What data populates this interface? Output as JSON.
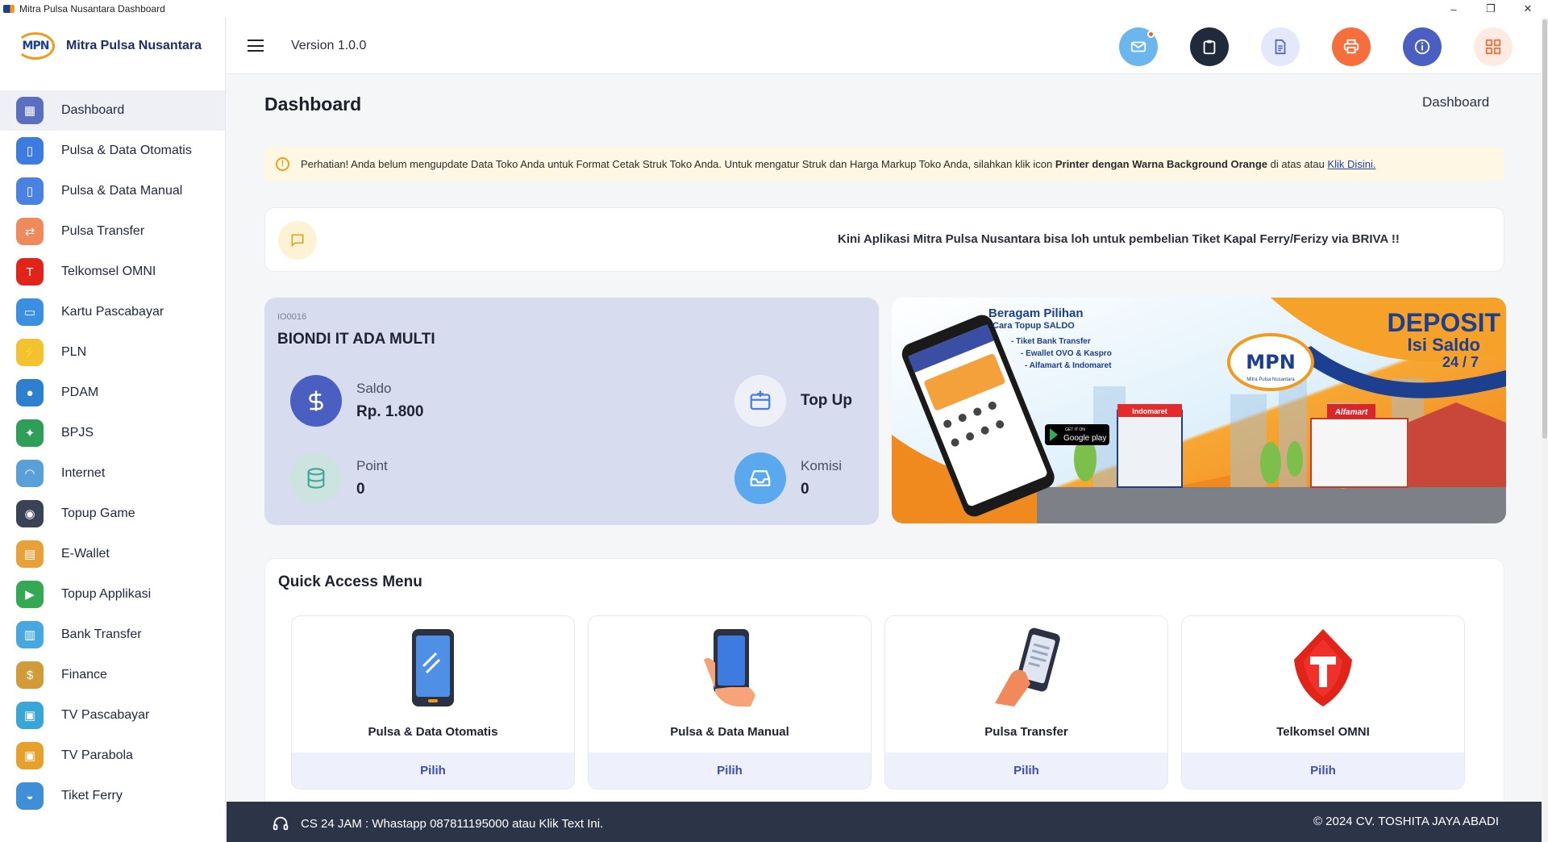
{
  "window": {
    "title": "Mitra Pulsa Nusantara Dashboard"
  },
  "brand": {
    "logo_text": "MPN",
    "name": "Mitra Pulsa Nusantara"
  },
  "header": {
    "version": "Version 1.0.0"
  },
  "sidebar": {
    "items": [
      {
        "label": "Dashboard",
        "icon": "dashboard-icon",
        "color": "#5a6fbf"
      },
      {
        "label": "Pulsa & Data Otomatis",
        "icon": "phone-icon",
        "color": "#3d7be0"
      },
      {
        "label": "Pulsa & Data Manual",
        "icon": "phone-hand-icon",
        "color": "#4a82e4"
      },
      {
        "label": "Pulsa Transfer",
        "icon": "transfer-icon",
        "color": "#f08a5d"
      },
      {
        "label": "Telkomsel OMNI",
        "icon": "telkomsel-icon",
        "color": "#e2231a"
      },
      {
        "label": "Kartu Pascabayar",
        "icon": "card-icon",
        "color": "#3b8fe0"
      },
      {
        "label": "PLN",
        "icon": "pln-icon",
        "color": "#f2c230"
      },
      {
        "label": "PDAM",
        "icon": "water-drop-icon",
        "color": "#2d7fd0"
      },
      {
        "label": "BPJS",
        "icon": "bpjs-icon",
        "color": "#2f9e58"
      },
      {
        "label": "Internet",
        "icon": "wifi-icon",
        "color": "#5aa0d8"
      },
      {
        "label": "Topup Game",
        "icon": "gamepad-icon",
        "color": "#3a4356"
      },
      {
        "label": "E-Wallet",
        "icon": "wallet-icon",
        "color": "#e8a13a"
      },
      {
        "label": "Topup Applikasi",
        "icon": "play-store-icon",
        "color": "#34a853"
      },
      {
        "label": "Bank Transfer",
        "icon": "bank-icon",
        "color": "#47a7e0"
      },
      {
        "label": "Finance",
        "icon": "finance-icon",
        "color": "#d19b3a"
      },
      {
        "label": "TV Pascabayar",
        "icon": "tv-icon",
        "color": "#3aa6d8"
      },
      {
        "label": "TV Parabola",
        "icon": "tv-antenna-icon",
        "color": "#e6a02b"
      },
      {
        "label": "Tiket Ferry",
        "icon": "ship-icon",
        "color": "#3f8ed8"
      }
    ]
  },
  "page": {
    "title": "Dashboard",
    "breadcrumb": "Dashboard"
  },
  "alert": {
    "text_1": "Perhatian! Anda belum mengupdate Data Toko Anda untuk Format Cetak Struk Toko Anda. Untuk mengatur Struk dan Harga Markup Toko Anda, silahkan klik icon ",
    "bold": "Printer dengan Warna Background Orange",
    "text_2": " di atas atau ",
    "link": "Klik Disini."
  },
  "announcement": "Kini Aplikasi Mitra Pulsa Nusantara bisa loh untuk pembelian Tiket Kapal Ferry/Ferizy via BRIVA !!",
  "account": {
    "code": "IO0016",
    "name": "BIONDI IT ADA MULTI",
    "saldo_label": "Saldo",
    "saldo_value": "Rp. 1.800",
    "point_label": "Point",
    "point_value": "0",
    "topup_label": "Top Up",
    "komisi_label": "Komisi",
    "komisi_value": "0"
  },
  "banner": {
    "headline": "Beragam Pilihan",
    "subheadline": "Cara Topup SALDO",
    "bullets": [
      "- Tiket Bank Transfer",
      "- Ewallet OVO & Kaspro",
      "- Alfamart & Indomaret"
    ],
    "deposit": "DEPOSIT",
    "isi_saldo": "Isi Saldo",
    "hours": "24 / 7",
    "logo": "MPN",
    "logo_caption": "Mitra Pulsa Nusantara",
    "store_1": "Indomaret",
    "store_2": "Alfamart",
    "store_badge_get": "GET IT ON",
    "store_badge": "Google play"
  },
  "quick_access": {
    "title": "Quick Access Menu",
    "cards": [
      {
        "label": "Pulsa & Data Otomatis",
        "button": "Pilih",
        "icon": "phone-icon"
      },
      {
        "label": "Pulsa & Data Manual",
        "button": "Pilih",
        "icon": "phone-hand-icon"
      },
      {
        "label": "Pulsa Transfer",
        "button": "Pilih",
        "icon": "transfer-icon"
      },
      {
        "label": "Telkomsel OMNI",
        "button": "Pilih",
        "icon": "telkomsel-icon"
      }
    ]
  },
  "footer": {
    "cs": "CS 24 JAM : Whastapp 087811195000 atau Klik Text Ini.",
    "copyright": "© 2024 CV. TOSHITA JAYA ABADI"
  },
  "colors": {
    "accent": "#4a5fc1",
    "orange": "#f56e3c",
    "navy": "#1f2a3a",
    "footer": "#2c3448"
  }
}
